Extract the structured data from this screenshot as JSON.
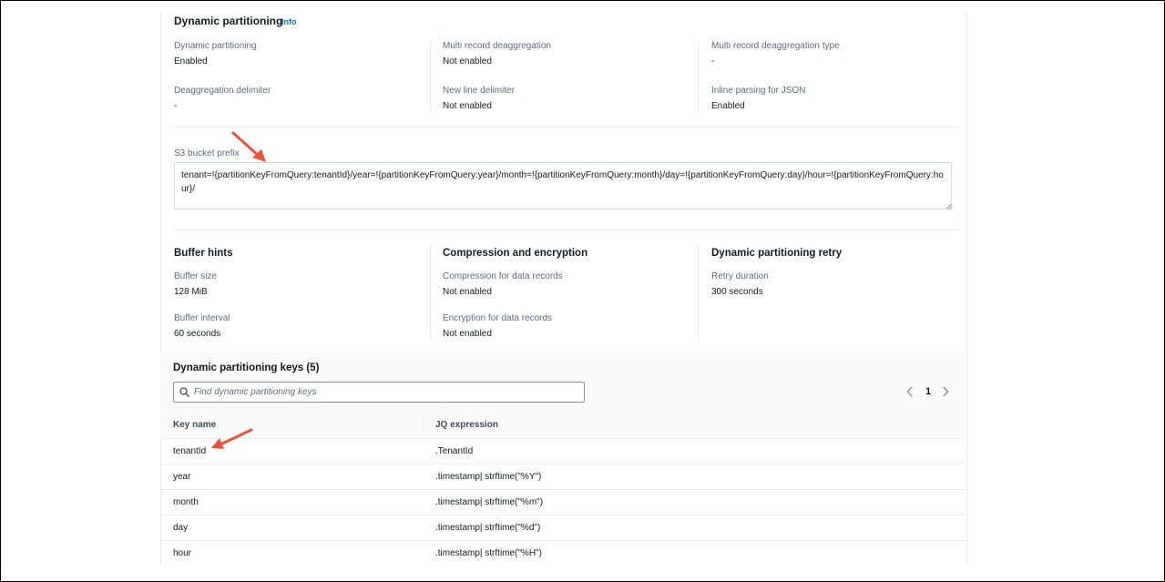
{
  "partitioning": {
    "title": "Dynamic partitioning",
    "info": "Info",
    "fields": [
      {
        "label": "Dynamic partitioning",
        "value": "Enabled"
      },
      {
        "label": "Multi record deaggregation",
        "value": "Not enabled"
      },
      {
        "label": "Multi record deaggregation type",
        "value": "-"
      },
      {
        "label": "Deaggregation delimiter",
        "value": "-"
      },
      {
        "label": "New line delimiter",
        "value": "Not enabled"
      },
      {
        "label": "Inline parsing for JSON",
        "value": "Enabled"
      }
    ]
  },
  "s3_prefix": {
    "label": "S3 bucket prefix",
    "value": "tenant=!{partitionKeyFromQuery:tenantId}/year=!{partitionKeyFromQuery:year}/month=!{partitionKeyFromQuery:month}/day=!{partitionKeyFromQuery:day}/hour=!{partitionKeyFromQuery:hour}/"
  },
  "buffer": {
    "title": "Buffer hints",
    "fields": [
      {
        "label": "Buffer size",
        "value": "128 MiB"
      },
      {
        "label": "Buffer interval",
        "value": "60 seconds"
      }
    ]
  },
  "compression": {
    "title": "Compression and encryption",
    "fields": [
      {
        "label": "Compression for data records",
        "value": "Not enabled"
      },
      {
        "label": "Encryption for data records",
        "value": "Not enabled"
      }
    ]
  },
  "retry": {
    "title": "Dynamic partitioning retry",
    "fields": [
      {
        "label": "Retry duration",
        "value": "300 seconds"
      }
    ]
  },
  "keys": {
    "title": "Dynamic partitioning keys (5)",
    "search_placeholder": "Find dynamic partitioning keys",
    "page": "1",
    "columns": [
      "Key name",
      "JQ expression"
    ],
    "rows": [
      {
        "key": "tenantId",
        "expr": ".TenantId"
      },
      {
        "key": "year",
        "expr": ".timestamp| strftime(\"%Y\")"
      },
      {
        "key": "month",
        "expr": ".timestamp| strftime(\"%m\")"
      },
      {
        "key": "day",
        "expr": ".timestamp| strftime(\"%d\")"
      },
      {
        "key": "hour",
        "expr": ".timestamp| strftime(\"%H\")"
      }
    ]
  },
  "colors": {
    "link": "#0972d3",
    "arrow": "#e8533d",
    "text": "#16191f",
    "label": "#5f6b7a"
  },
  "icons": {
    "search": "search-icon",
    "prev": "chevron-left-icon",
    "next": "chevron-right-icon",
    "resize": "resize-grip-icon",
    "annotation": "arrow-annotation-icon"
  }
}
